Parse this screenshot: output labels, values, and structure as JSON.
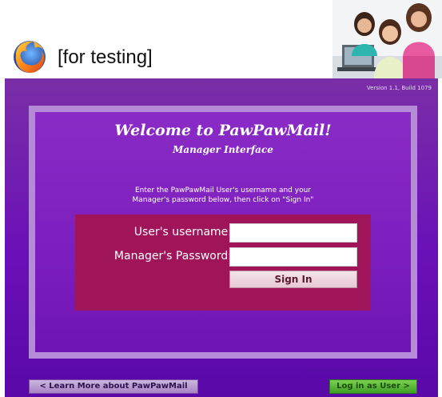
{
  "header": {
    "browser_logo_icon": "firefox-logo-icon",
    "testing_label": "[for testing]",
    "photo": "three-smiling-women-at-laptop"
  },
  "main": {
    "version": "Version 1.1, Build 1079",
    "welcome_title": "Welcome to PawPawMail!",
    "welcome_subtitle": "Manager Interface",
    "instructions_line1": "Enter the PawPawMail User's username and your",
    "instructions_line2": "Manager's password below, then click on \"Sign In\"",
    "form": {
      "username_label": "User's username:",
      "username_value": "",
      "password_label": "Manager's Password:",
      "password_value": "",
      "signin_label": "Sign In"
    },
    "learn_more_label": "< Learn More about PawPawMail",
    "log_in_user_label": "Log in as User >"
  },
  "colors": {
    "panel_purple": "#6a10b8",
    "frame_lavender": "#b58ad6",
    "login_box": "#a0145a",
    "green_button": "#3ea126"
  }
}
